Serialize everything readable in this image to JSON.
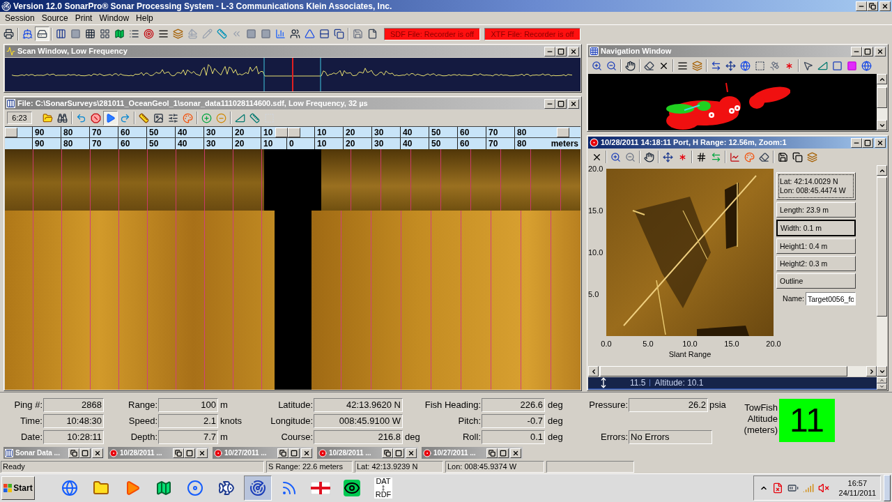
{
  "window": {
    "title": "Version 12.0 SonarPro® Sonar Processing System - L-3 Communications Klein Associates, Inc."
  },
  "menu": [
    "Session",
    "Source",
    "Print",
    "Window",
    "Help"
  ],
  "toolbar": {
    "buttons": [
      {
        "pressed": false
      },
      {
        "pressed": false
      },
      {
        "pressed": true
      },
      {
        "pressed": false
      },
      {
        "pressed": false
      },
      {
        "pressed": false
      },
      {
        "pressed": false
      },
      {
        "pressed": false
      },
      {
        "pressed": false
      },
      {
        "pressed": false
      },
      {
        "pressed": false
      },
      {
        "pressed": false
      },
      {
        "pressed": false
      },
      {
        "pressed": false
      },
      {
        "pressed": false
      },
      {
        "pressed": false
      },
      {
        "pressed": false
      },
      {
        "pressed": false
      },
      {
        "pressed": false
      },
      {
        "pressed": false
      },
      {
        "pressed": false
      },
      {
        "pressed": false
      },
      {
        "pressed": false
      },
      {
        "pressed": false
      },
      {
        "pressed": false
      }
    ],
    "recorders": [
      "SDF File: Recorder is off",
      "XTF File: Recorder is off"
    ]
  },
  "scan_window": {
    "title": "Scan Window, Low Frequency",
    "active": false
  },
  "file_window": {
    "title": "File: C:\\SonarSurveys\\281011_OceanGeol_1\\sonar_data111028114600.sdf, Low Frequency, 32 µs",
    "active": false,
    "time": "6:23",
    "toolbar": [
      {
        "pressed": false
      },
      {
        "pressed": false
      },
      {
        "pressed": false
      },
      {
        "pressed": false
      },
      {
        "pressed": true
      },
      {
        "pressed": false
      },
      {
        "pressed": false
      },
      {
        "pressed": false
      },
      {
        "pressed": false
      },
      {
        "pressed": false
      },
      {
        "pressed": false
      },
      {
        "pressed": false
      },
      {
        "pressed": false
      },
      {
        "pressed": false
      },
      {
        "pressed": false
      }
    ],
    "scale_upper": {
      "port": [
        "90",
        "80",
        "70",
        "60",
        "50",
        "40",
        "30",
        "20",
        "10"
      ],
      "starboard": [
        "10",
        "20",
        "30",
        "40",
        "50",
        "60",
        "70",
        "80"
      ]
    },
    "scale_lower": {
      "port": [
        "90",
        "80",
        "70",
        "60",
        "50",
        "40",
        "30",
        "20",
        "10"
      ],
      "center": "0",
      "starboard": [
        "10",
        "20",
        "30",
        "40",
        "50",
        "60",
        "70",
        "80"
      ],
      "unit": "meters"
    }
  },
  "navigation_window": {
    "title": "Navigation Window",
    "active": false
  },
  "target_window": {
    "title": "10/28/2011 14:18:11 Port, H Range: 12.56m, Zoom:1",
    "active": true,
    "y_ticks": [
      "20.0",
      "15.0",
      "10.0",
      "5.0"
    ],
    "x_ticks": [
      "0.0",
      "5.0",
      "10.0",
      "15.0",
      "20.0"
    ],
    "x_label": "Slant Range",
    "measurements": [
      {
        "lines": [
          "Lat: 42:14.0029 N",
          "Lon: 008:45.4474 W"
        ],
        "focused": true,
        "selected": false
      },
      {
        "lines": [
          "Length: 23.9 m"
        ],
        "focused": false,
        "selected": false
      },
      {
        "lines": [
          "Width: 0.1 m"
        ],
        "focused": false,
        "selected": true
      },
      {
        "lines": [
          "Height1: 0.4 m"
        ],
        "focused": false,
        "selected": false
      },
      {
        "lines": [
          "Height2: 0.3 m"
        ],
        "focused": false,
        "selected": false
      },
      {
        "lines": [
          "Outline"
        ],
        "focused": false,
        "selected": false
      }
    ],
    "name_label": "Name:",
    "name_value": "Target0056_fo",
    "depth": "11.5",
    "altitude": "Altitude: 10.1"
  },
  "status_panel": {
    "columns": [
      [
        {
          "label": "Ping #:",
          "value": "2868"
        },
        {
          "label": "Time:",
          "value": "10:48:30"
        },
        {
          "label": "Date:",
          "value": "10:28:11"
        }
      ],
      [
        {
          "label": "Range:",
          "value": "100",
          "unit": "m"
        },
        {
          "label": "Speed:",
          "value": "2.1",
          "unit": "knots"
        },
        {
          "label": "Depth:",
          "value": "7.7",
          "unit": "m"
        }
      ],
      [
        {
          "label": "Latitude:",
          "value": "42:13.9620 N"
        },
        {
          "label": "Longitude:",
          "value": "008:45.9100 W"
        },
        {
          "label": "Course:",
          "value": "216.8",
          "unit": "deg"
        }
      ],
      [
        {
          "label": "Fish Heading:",
          "value": "226.6",
          "unit": "deg"
        },
        {
          "label": "Pitch:",
          "value": "-0.7",
          "unit": "deg"
        },
        {
          "label": "Roll:",
          "value": "0.1",
          "unit": "deg"
        }
      ],
      [
        {
          "label": "Pressure:",
          "value": "26.2",
          "unit": "psia"
        }
      ]
    ],
    "errors": {
      "label": "Errors:",
      "value": "No Errors"
    },
    "towfish": {
      "label": "TowFish Altitude (meters)",
      "value": "11"
    }
  },
  "minimized_windows": [
    {
      "kind": "data",
      "title": "Sonar Data ..."
    },
    {
      "kind": "target",
      "title": "10/28/2011 ..."
    },
    {
      "kind": "target",
      "title": "10/27/2011 ..."
    },
    {
      "kind": "target",
      "title": "10/28/2011 ..."
    },
    {
      "kind": "target",
      "title": "10/27/2011 ..."
    }
  ],
  "status_bar": [
    "Ready",
    "S Range: 22.6 meters",
    "Lat: 42:13.9239 N",
    "Lon: 008:45.9374 W"
  ],
  "taskbar": {
    "start": "Start",
    "apps": [
      {
        "selected": false
      },
      {
        "selected": false
      },
      {
        "selected": false
      },
      {
        "selected": false
      },
      {
        "selected": false
      },
      {
        "selected": false
      },
      {
        "selected": true
      },
      {
        "selected": false
      },
      {
        "selected": false
      },
      {
        "selected": false
      },
      {
        "selected": false,
        "top": "DAT",
        "bottom": "RDF"
      }
    ],
    "time": "16:57",
    "date": "24/11/2011"
  }
}
